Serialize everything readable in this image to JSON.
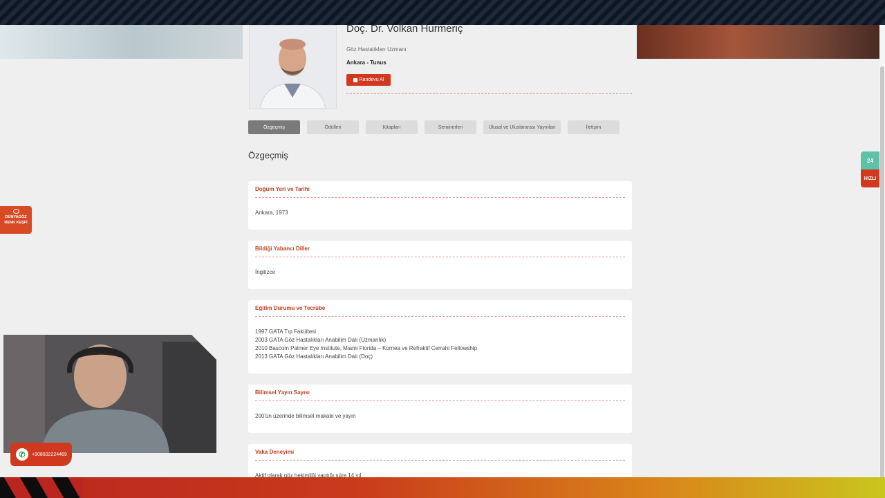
{
  "doctor": {
    "name": "Doç. Dr. Volkan Hurmeriç",
    "specialty": "Göz Hastalıkları Uzmanı",
    "location": "Ankara - Tunus",
    "appointment_label": "Randevu Al"
  },
  "tabs": [
    {
      "label": "Özgeçmiş",
      "active": true
    },
    {
      "label": "Ödülleri",
      "active": false
    },
    {
      "label": "Kitapları",
      "active": false
    },
    {
      "label": "Seminerleri",
      "active": false
    },
    {
      "label": "Ulusal ve Uluslararası Yayınları",
      "active": false
    },
    {
      "label": "İletişim",
      "active": false
    }
  ],
  "section_title": "Özgeçmiş",
  "cards": [
    {
      "title": "Doğum Yeri ve Tarihi",
      "lines": [
        "Ankara, 1973"
      ]
    },
    {
      "title": "Bildiği Yabancı Diller",
      "lines": [
        "İngilizce"
      ]
    },
    {
      "title": "Eğitim Durumu ve Tecrübe",
      "lines": [
        "1997 GATA Tıp Fakültesi",
        "2003 GATA Göz Hastalıkları Anabilim Dalı (Uzmanlık)",
        "2010 Bascom Palmer Eye Institute, Miami Florida – Kornea ve Refraktif Cerrahi Fellowship",
        "2013 GATA Göz Hastalıkları Anabilim Dalı (Doç)"
      ]
    },
    {
      "title": "Bilimsel Yayın Sayısı",
      "lines": [
        "200'ün üzerinde bilimsel makale ve yayın"
      ]
    },
    {
      "title": "Vaka Deneyimi",
      "lines": [
        "Aktif olarak göz hekimliği yaptığı süre 14 yıl"
      ]
    }
  ],
  "side_left": {
    "line1": "DÜNYAGÖZ",
    "line2": "RENK KEŞFİ"
  },
  "side_right": {
    "badge": "24",
    "label": "HIZLI"
  },
  "whatsapp": {
    "phone": "+908502224469"
  },
  "colors": {
    "accent": "#d0391f",
    "tab_active": "#7a7a7a",
    "tab": "#dcdcdc",
    "page_bg": "#efefef"
  }
}
